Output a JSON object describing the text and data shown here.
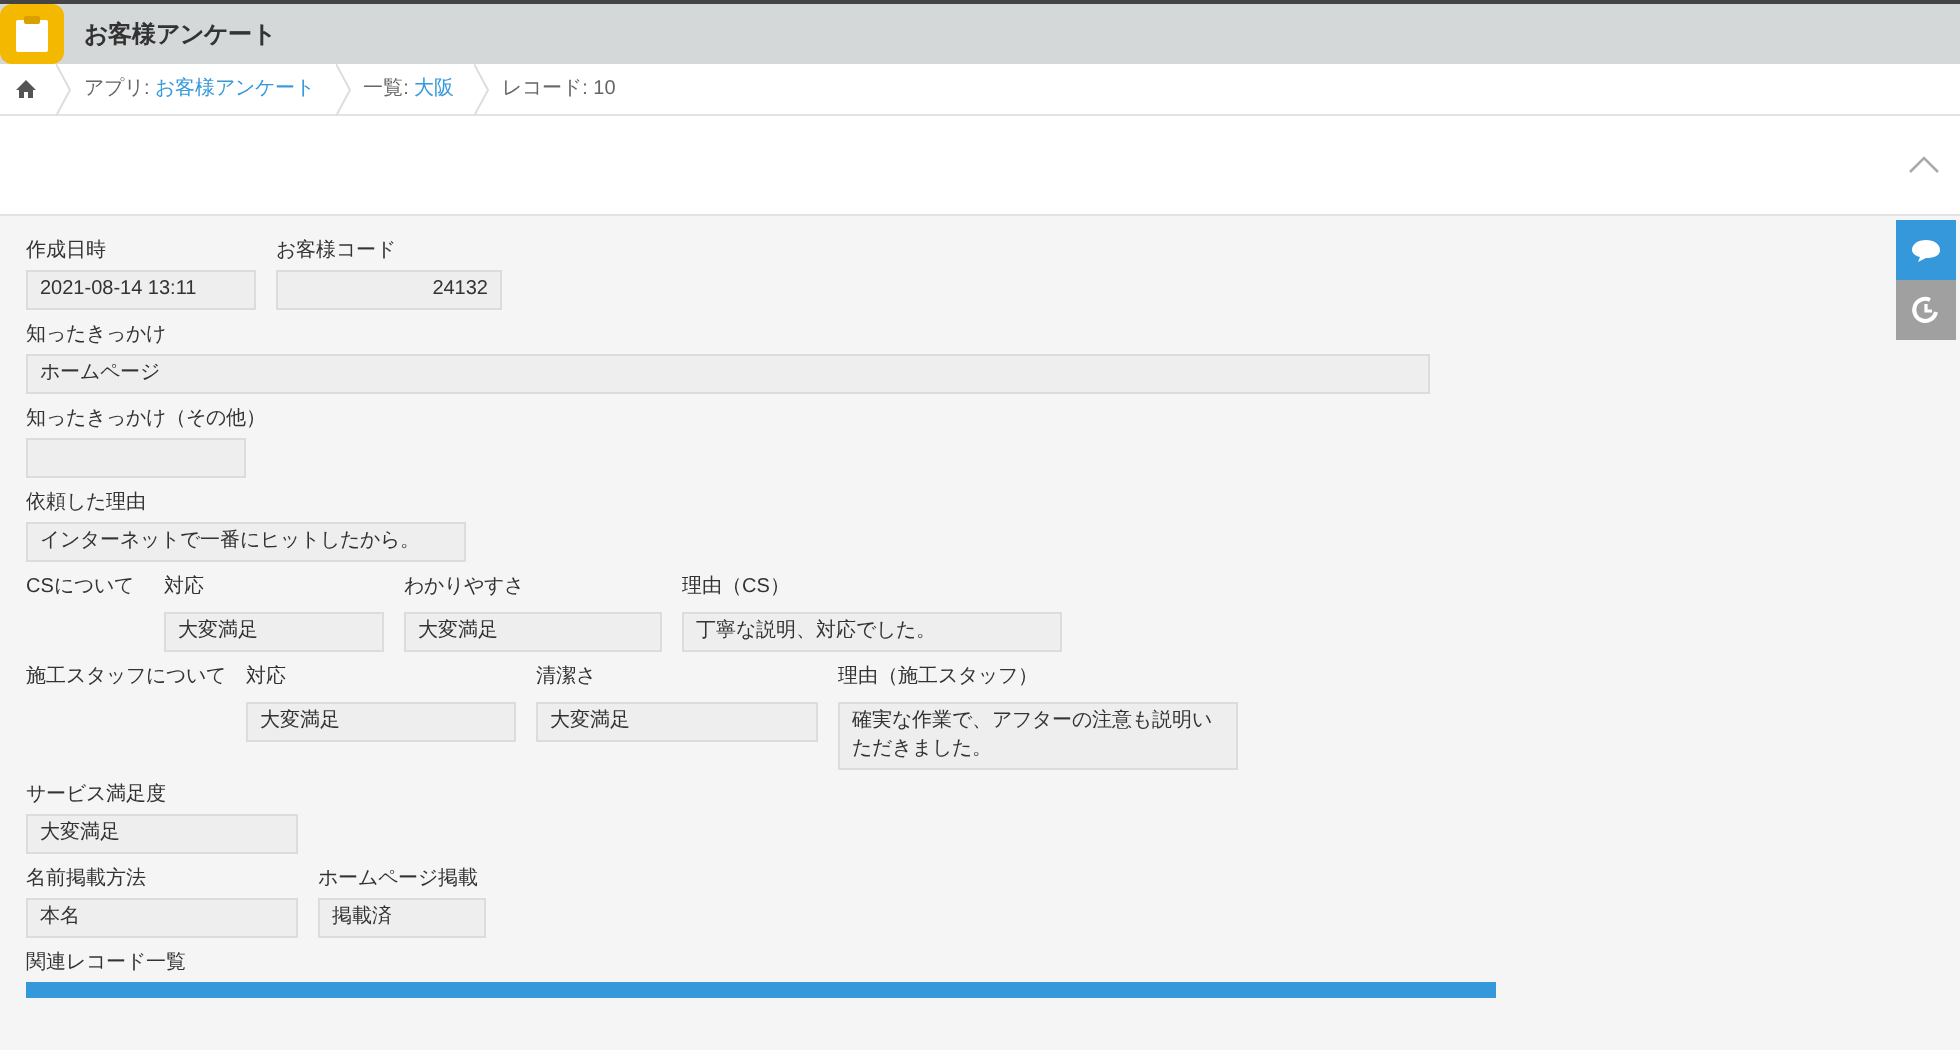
{
  "app": {
    "title": "お客様アンケート"
  },
  "breadcrumb": [
    {
      "prefix": "アプリ: ",
      "link": "お客様アンケート"
    },
    {
      "prefix": "一覧: ",
      "link": "大阪"
    },
    {
      "prefix": "レコード: 10"
    }
  ],
  "rows": [
    {
      "fields": [
        {
          "label": "作成日時",
          "value": "2021-08-14 13:11"
        },
        {
          "label": "お客様コード",
          "value": "24132",
          "kind": "number"
        }
      ]
    },
    {
      "fields": [
        {
          "label": "知ったきっかけ",
          "value": "ホームページ"
        }
      ]
    },
    {
      "fields": [
        {
          "label": "知ったきっかけ（その他）"
        }
      ]
    },
    {
      "fields": [
        {
          "label": "依頼した理由",
          "value": "インターネットで一番にヒットしたから。"
        }
      ]
    },
    {
      "group_label": "CSについて",
      "fields": [
        {
          "label": "対応",
          "value": "大変満足"
        },
        {
          "label": "わかりやすさ",
          "value": "大変満足"
        },
        {
          "label": "理由（CS）",
          "value": "丁寧な説明、対応でした。"
        }
      ]
    },
    {
      "group_label": "施工スタッフについて",
      "fields": [
        {
          "label": "対応",
          "value": "大変満足"
        },
        {
          "label": "清潔さ",
          "value": "大変満足"
        },
        {
          "label": "理由（施工スタッフ）",
          "value": "確実な作業で、アフターの注意も説明いただきました。"
        }
      ]
    },
    {
      "fields": [
        {
          "label": "サービス満足度",
          "value": "大変満足"
        }
      ]
    },
    {
      "fields": [
        {
          "label": "名前掲載方法",
          "value": "本名"
        },
        {
          "label": "ホームページ掲載",
          "value": "掲載済"
        }
      ]
    }
  ],
  "related": {
    "label": "関連レコード一覧"
  }
}
